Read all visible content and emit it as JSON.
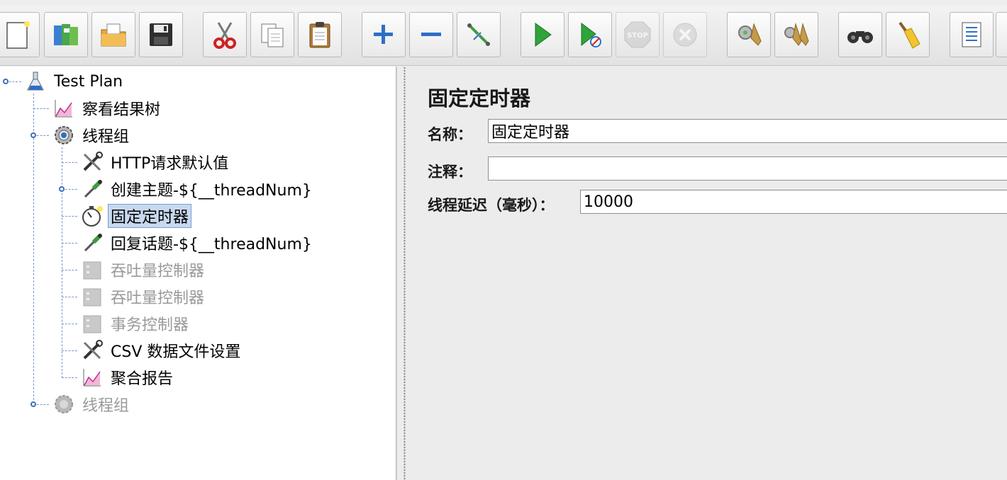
{
  "toolbar": {
    "buttons": [
      {
        "name": "new-button",
        "icon": "new-document-icon",
        "enabled": true
      },
      {
        "name": "templates-button",
        "icon": "templates-books-icon",
        "enabled": true
      },
      {
        "name": "open-button",
        "icon": "open-folder-icon",
        "enabled": true
      },
      {
        "name": "save-button",
        "icon": "floppy-disk-icon",
        "enabled": true
      },
      {
        "name": "cut-button",
        "icon": "scissors-icon",
        "enabled": true
      },
      {
        "name": "copy-button",
        "icon": "copy-icon",
        "enabled": true
      },
      {
        "name": "paste-button",
        "icon": "clipboard-icon",
        "enabled": true
      },
      {
        "name": "expand-button",
        "icon": "plus-icon",
        "enabled": true
      },
      {
        "name": "collapse-button",
        "icon": "minus-icon",
        "enabled": true
      },
      {
        "name": "toggle-button",
        "icon": "toggle-pipettes-icon",
        "enabled": true
      },
      {
        "name": "start-button",
        "icon": "play-icon",
        "enabled": true
      },
      {
        "name": "start-no-pauses-button",
        "icon": "play-no-timer-icon",
        "enabled": true
      },
      {
        "name": "stop-button",
        "icon": "stop-icon",
        "enabled": false
      },
      {
        "name": "shutdown-button",
        "icon": "shutdown-icon",
        "enabled": false
      },
      {
        "name": "clear-button",
        "icon": "clear-broom-gear-icon",
        "enabled": true
      },
      {
        "name": "clear-all-button",
        "icon": "clear-all-brooms-icon",
        "enabled": true
      },
      {
        "name": "search-button",
        "icon": "binoculars-icon",
        "enabled": true
      },
      {
        "name": "reset-search-button",
        "icon": "broom-icon",
        "enabled": true
      },
      {
        "name": "function-helper-button",
        "icon": "list-icon",
        "enabled": true
      }
    ]
  },
  "tree": {
    "nodes": [
      {
        "label": "Test Plan",
        "icon": "flask-icon",
        "disabled": false,
        "selected": false
      },
      {
        "label": "察看结果树",
        "icon": "graph-results-icon",
        "disabled": false,
        "selected": false
      },
      {
        "label": "线程组",
        "icon": "gear-icon",
        "disabled": false,
        "selected": false
      },
      {
        "label": "HTTP请求默认值",
        "icon": "wrench-screwdriver-icon",
        "disabled": false,
        "selected": false
      },
      {
        "label": "创建主题-${__threadNum}",
        "icon": "pipette-icon",
        "disabled": false,
        "selected": false
      },
      {
        "label": "固定定时器",
        "icon": "stopwatch-icon",
        "disabled": false,
        "selected": true
      },
      {
        "label": "回复话题-${__threadNum}",
        "icon": "pipette-icon",
        "disabled": false,
        "selected": false
      },
      {
        "label": "吞吐量控制器",
        "icon": "controller-icon",
        "disabled": true,
        "selected": false
      },
      {
        "label": "吞吐量控制器",
        "icon": "controller-icon",
        "disabled": true,
        "selected": false
      },
      {
        "label": "事务控制器",
        "icon": "controller-icon",
        "disabled": true,
        "selected": false
      },
      {
        "label": "CSV 数据文件设置",
        "icon": "wrench-screwdriver-icon",
        "disabled": false,
        "selected": false
      },
      {
        "label": "聚合报告",
        "icon": "graph-results-icon",
        "disabled": false,
        "selected": false
      },
      {
        "label": "线程组",
        "icon": "gear-icon",
        "disabled": true,
        "selected": false
      }
    ]
  },
  "panel": {
    "title": "固定定时器",
    "name_label": "名称：",
    "name_value": "固定定时器",
    "comment_label": "注释：",
    "comment_value": "",
    "delay_label": "线程延迟（毫秒）：",
    "delay_value": "10000"
  }
}
